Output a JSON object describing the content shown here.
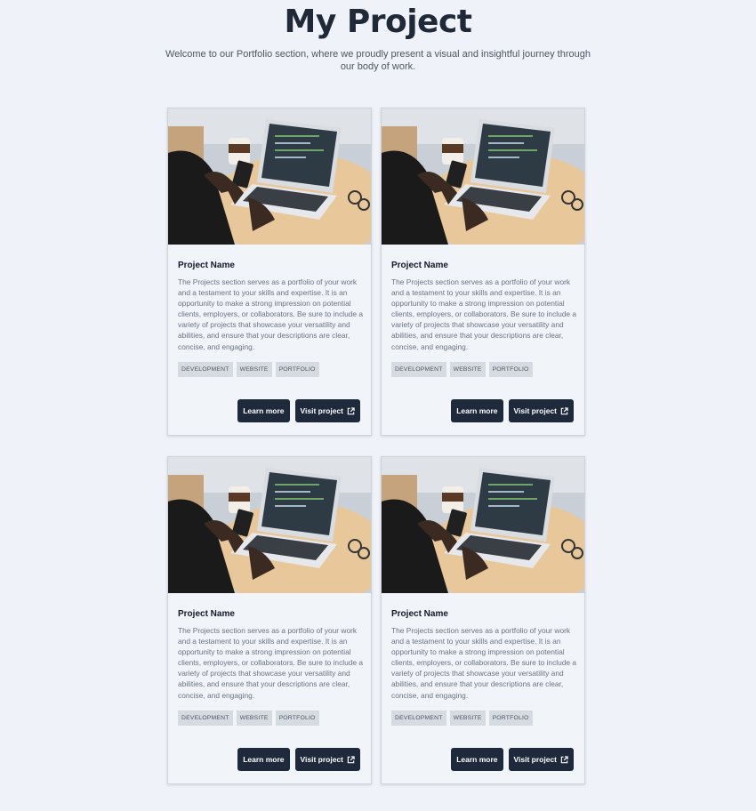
{
  "header": {
    "title": "My Project",
    "subtitle": "Welcome to our Portfolio section, where we proudly present a visual and insightful journey through our body of work."
  },
  "cards": [
    {
      "name": "Project Name",
      "description": "The Projects section serves as a portfolio of your work and a testament to your skills and expertise. It is an opportunity to make a strong impression on potential clients, employers, or collaborators. Be sure to include a variety of projects that showcase your versatility and abilities, and ensure that your descriptions are clear, concise, and engaging.",
      "tags": [
        "DEVELOPMENT",
        "WEBSITE",
        "PORTFOLIO"
      ],
      "learn_more_label": "Learn more",
      "visit_label": "Visit project"
    },
    {
      "name": "Project Name",
      "description": "The Projects section serves as a portfolio of your work and a testament to your skills and expertise. It is an opportunity to make a strong impression on potential clients, employers, or collaborators. Be sure to include a variety of projects that showcase your versatility and abilities, and ensure that your descriptions are clear, concise, and engaging.",
      "tags": [
        "DEVELOPMENT",
        "WEBSITE",
        "PORTFOLIO"
      ],
      "learn_more_label": "Learn more",
      "visit_label": "Visit project"
    },
    {
      "name": "Project Name",
      "description": "The Projects section serves as a portfolio of your work and a testament to your skills and expertise. It is an opportunity to make a strong impression on potential clients, employers, or collaborators. Be sure to include a variety of projects that showcase your versatility and abilities, and ensure that your descriptions are clear, concise, and engaging.",
      "tags": [
        "DEVELOPMENT",
        "WEBSITE",
        "PORTFOLIO"
      ],
      "learn_more_label": "Learn more",
      "visit_label": "Visit project"
    },
    {
      "name": "Project Name",
      "description": "The Projects section serves as a portfolio of your work and a testament to your skills and expertise. It is an opportunity to make a strong impression on potential clients, employers, or collaborators. Be sure to include a variety of projects that showcase your versatility and abilities, and ensure that your descriptions are clear, concise, and engaging.",
      "tags": [
        "DEVELOPMENT",
        "WEBSITE",
        "PORTFOLIO"
      ],
      "learn_more_label": "Learn more",
      "visit_label": "Visit project"
    }
  ],
  "icons": {
    "visit": "external-link-icon",
    "image": "laptop-workspace-photo"
  },
  "colors": {
    "background": "#eff3f9",
    "button": "#1e293b",
    "tag": "#d6dbe2",
    "title": "#1f2937"
  }
}
